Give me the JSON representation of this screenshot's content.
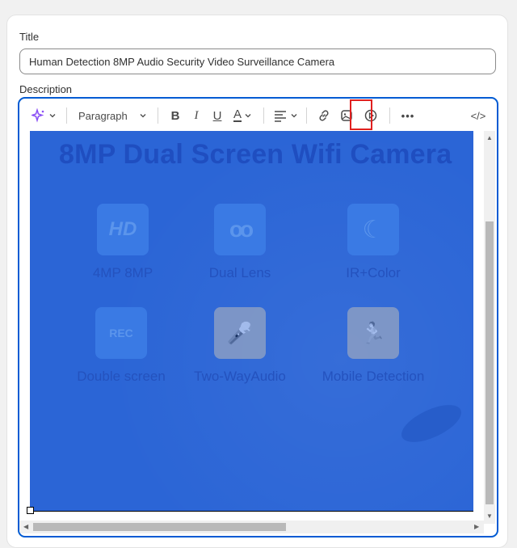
{
  "form": {
    "title_label": "Title",
    "title_value": "Human Detection 8MP Audio Security Video Surveillance Camera",
    "description_label": "Description"
  },
  "toolbar": {
    "ai_icon": "sparkle-icon",
    "paragraph_label": "Paragraph",
    "bold_label": "B",
    "italic_label": "I",
    "underline_label": "U",
    "color_label": "A",
    "more_label": "•••",
    "code_label": "</>"
  },
  "content": {
    "banner_title": "8MP Dual Screen Wifi Camera",
    "features": [
      {
        "icon_text": "HD",
        "label": "4MP 8MP"
      },
      {
        "icon_text": "oo",
        "label": "Dual Lens"
      },
      {
        "icon_text": "☾",
        "label": "IR+Color"
      },
      {
        "icon_text": "REC",
        "label": "Double screen"
      },
      {
        "icon_text": "🎤",
        "label": "Two-WayAudio"
      },
      {
        "icon_text": "🏃",
        "label": "Mobile Detection"
      }
    ]
  },
  "colors": {
    "accent": "#005bd3",
    "highlight": "#e0201f",
    "image_blue": "#2b65d6"
  }
}
